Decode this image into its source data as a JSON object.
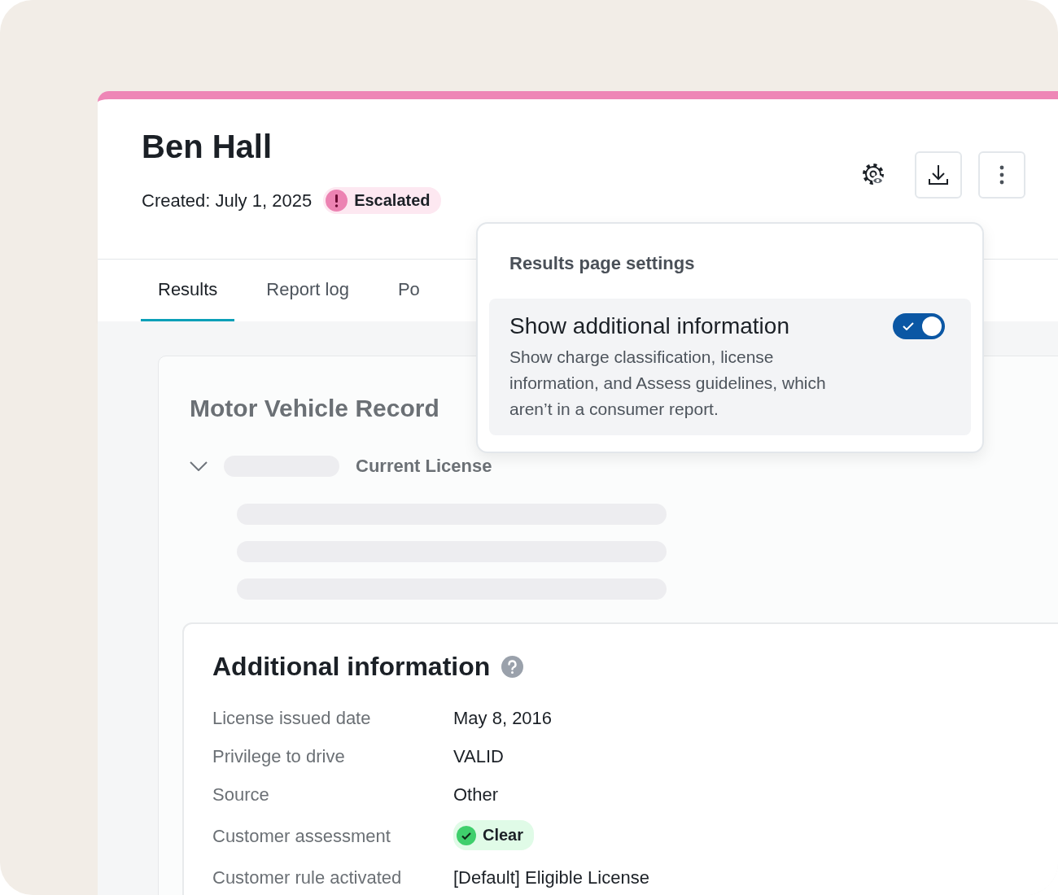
{
  "record": {
    "name": "Ben Hall",
    "created": "Created: July 1, 2025",
    "status": {
      "label": "Escalated",
      "kind": "escalated"
    }
  },
  "tabs": [
    {
      "label": "Results",
      "selected": true
    },
    {
      "label": "Report log",
      "selected": false
    },
    {
      "label": "Po",
      "selected": false
    }
  ],
  "section": {
    "title": "Motor Vehicle Record",
    "group": {
      "label": "Current License",
      "expanded": true
    }
  },
  "settings_popover": {
    "title": "Results page settings",
    "options": [
      {
        "label": "Show additional information",
        "description": "Show charge classification, license information, and Assess guidelines, which aren’t in a consumer report.",
        "on": true
      }
    ]
  },
  "additional_information": {
    "title": "Additional information",
    "fields": [
      {
        "label": "License issued date",
        "value": "May 8, 2016",
        "kind": "text"
      },
      {
        "label": "Privilege to drive",
        "value": "VALID",
        "kind": "text"
      },
      {
        "label": "Source",
        "value": "Other",
        "kind": "text"
      },
      {
        "label": "Customer assessment",
        "value": "Clear",
        "kind": "badge"
      },
      {
        "label": "Customer rule activated",
        "value": "[Default] Eligible License",
        "kind": "text"
      }
    ]
  }
}
